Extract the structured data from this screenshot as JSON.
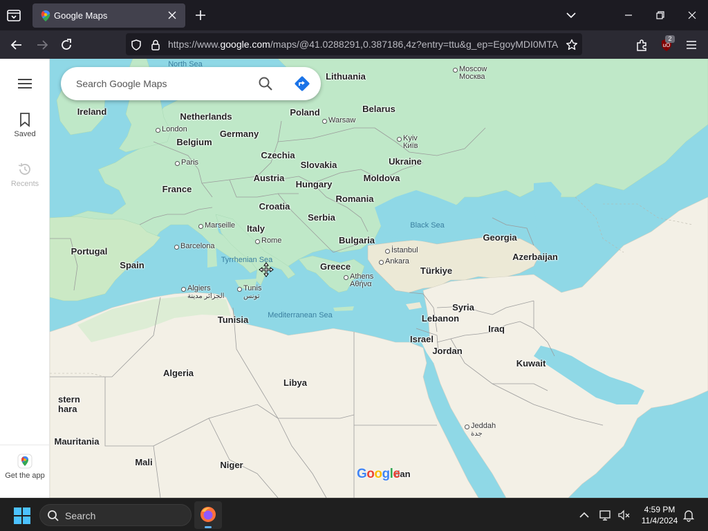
{
  "browser": {
    "tab_title": "Google Maps",
    "url_prefix": "https://www.",
    "url_domain": "google.com",
    "url_rest": "/maps/@41.0288291,0.387186,4z?entry=ttu&g_ep=EgoyMDI0MTA",
    "extension_badge": "2"
  },
  "sidebar": {
    "saved_label": "Saved",
    "recents_label": "Recents",
    "get_app_label": "Get the app"
  },
  "search": {
    "placeholder": "Search Google Maps"
  },
  "map": {
    "countries": {
      "ireland": "Ireland",
      "netherlands": "Netherlands",
      "poland": "Poland",
      "belarus": "Belarus",
      "lithuania": "Lithuania",
      "germany": "Germany",
      "belgium": "Belgium",
      "czechia": "Czechia",
      "slovakia": "Slovakia",
      "ukraine": "Ukraine",
      "austria": "Austria",
      "moldova": "Moldova",
      "hungary": "Hungary",
      "france": "France",
      "romania": "Romania",
      "croatia": "Croatia",
      "serbia": "Serbia",
      "italy": "Italy",
      "portugal": "Portugal",
      "spain": "Spain",
      "bulgaria": "Bulgaria",
      "georgia": "Georgia",
      "azerbaijan": "Azerbaijan",
      "greece": "Greece",
      "turkiye": "Türkiye",
      "syria": "Syria",
      "lebanon": "Lebanon",
      "iraq": "Iraq",
      "tunisia": "Tunisia",
      "israel": "Israel",
      "jordan": "Jordan",
      "kuwait": "Kuwait",
      "algeria": "Algeria",
      "libya": "Libya",
      "western_sahara": "stern\nhara",
      "mauritania": "Mauritania",
      "mali": "Mali",
      "niger": "Niger",
      "sudan": "dan"
    },
    "cities": {
      "moscow": "Moscow",
      "moscow_alt": "Москва",
      "london": "London",
      "warsaw": "Warsaw",
      "kyiv": "Kyiv",
      "kyiv_alt": "Київ",
      "paris": "Paris",
      "marseille": "Marseille",
      "rome": "Rome",
      "barcelona": "Barcelona",
      "istanbul": "İstanbul",
      "ankara": "Ankara",
      "athens": "Athens",
      "athens_alt": "Αθήνα",
      "algiers": "Algiers",
      "algiers_alt": "الجزائر مدينة",
      "tunis": "Tunis",
      "tunis_alt": "تونس",
      "jeddah": "Jeddah",
      "jeddah_alt": "جدة"
    },
    "seas": {
      "north_sea": "North Sea",
      "black_sea": "Black Sea",
      "tyrrhenian_sea": "Tyrrhenian Sea",
      "mediterranean_sea": "Mediterranean Sea"
    },
    "logo": "Google"
  },
  "taskbar": {
    "search_placeholder": "Search",
    "time": "4:59 PM",
    "date": "11/4/2024"
  },
  "colors": {
    "water": "#8fd8e6",
    "land_green": "#bfe8c8",
    "land_desert": "#f3f0e6",
    "brand_blue": "#1a73e8"
  }
}
